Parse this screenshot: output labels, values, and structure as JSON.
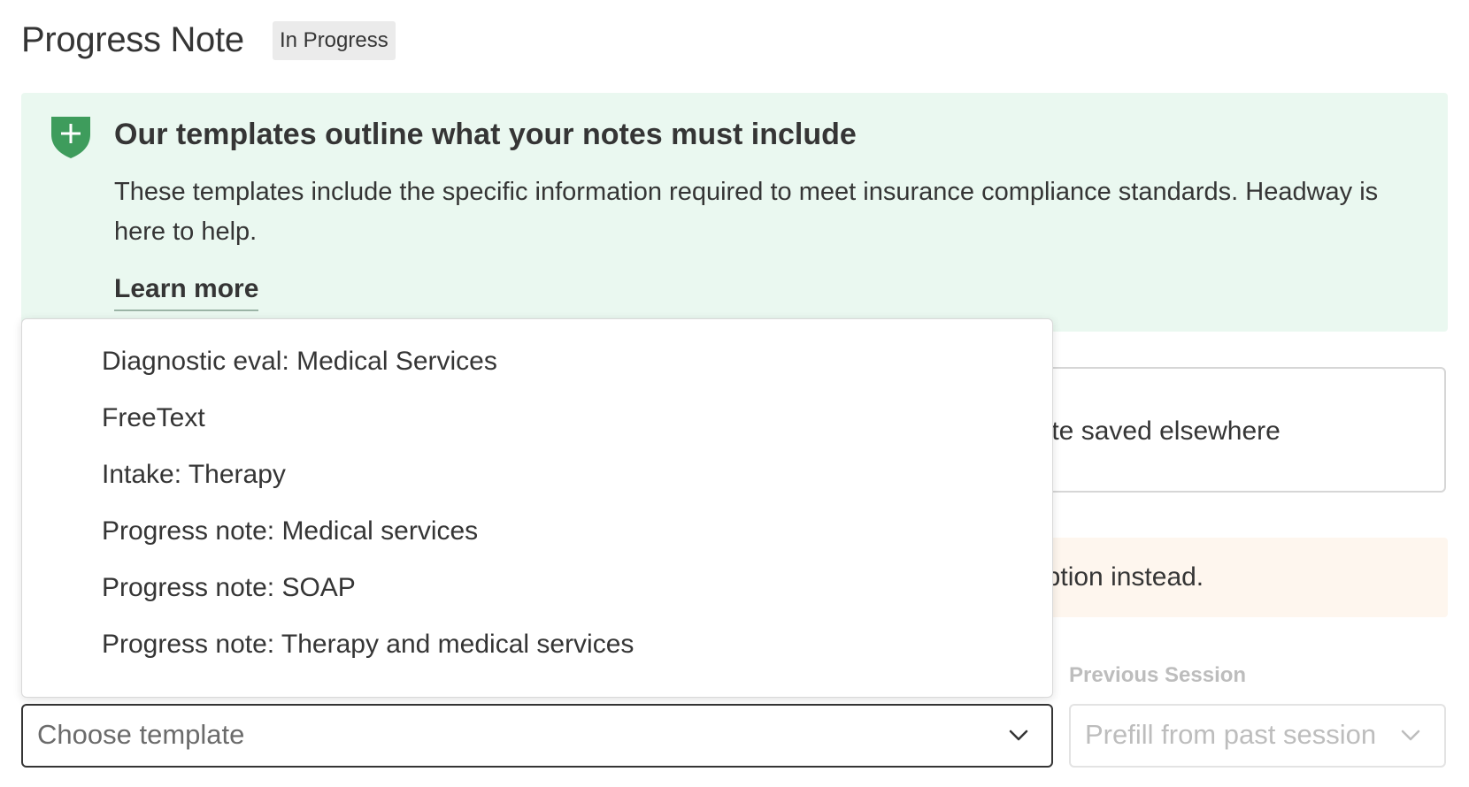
{
  "header": {
    "title": "Progress Note",
    "status_badge": "In Progress"
  },
  "compliance_banner": {
    "icon": "shield-plus-icon",
    "title": "Our templates outline what your notes must include",
    "body": "These templates include the specific information required to meet insurance compliance standards. Headway is here to help.",
    "link_label": "Learn more"
  },
  "option_card": {
    "partial_label": "lote saved elsewhere"
  },
  "warning_banner": {
    "partial_text": "option instead."
  },
  "template_select": {
    "placeholder": "Choose template",
    "options": [
      "Diagnostic eval: Medical Services",
      "FreeText",
      "Intake: Therapy",
      "Progress note: Medical services",
      "Progress note: SOAP",
      "Progress note: Therapy and medical services"
    ]
  },
  "previous_session": {
    "label": "Previous Session",
    "placeholder": "Prefill from past session"
  },
  "colors": {
    "banner_bg": "#eaf8f0",
    "shield_green": "#3e9c5c",
    "warning_bg": "#fef6ee",
    "text_primary": "#353535",
    "text_disabled": "#bdbdbd"
  }
}
